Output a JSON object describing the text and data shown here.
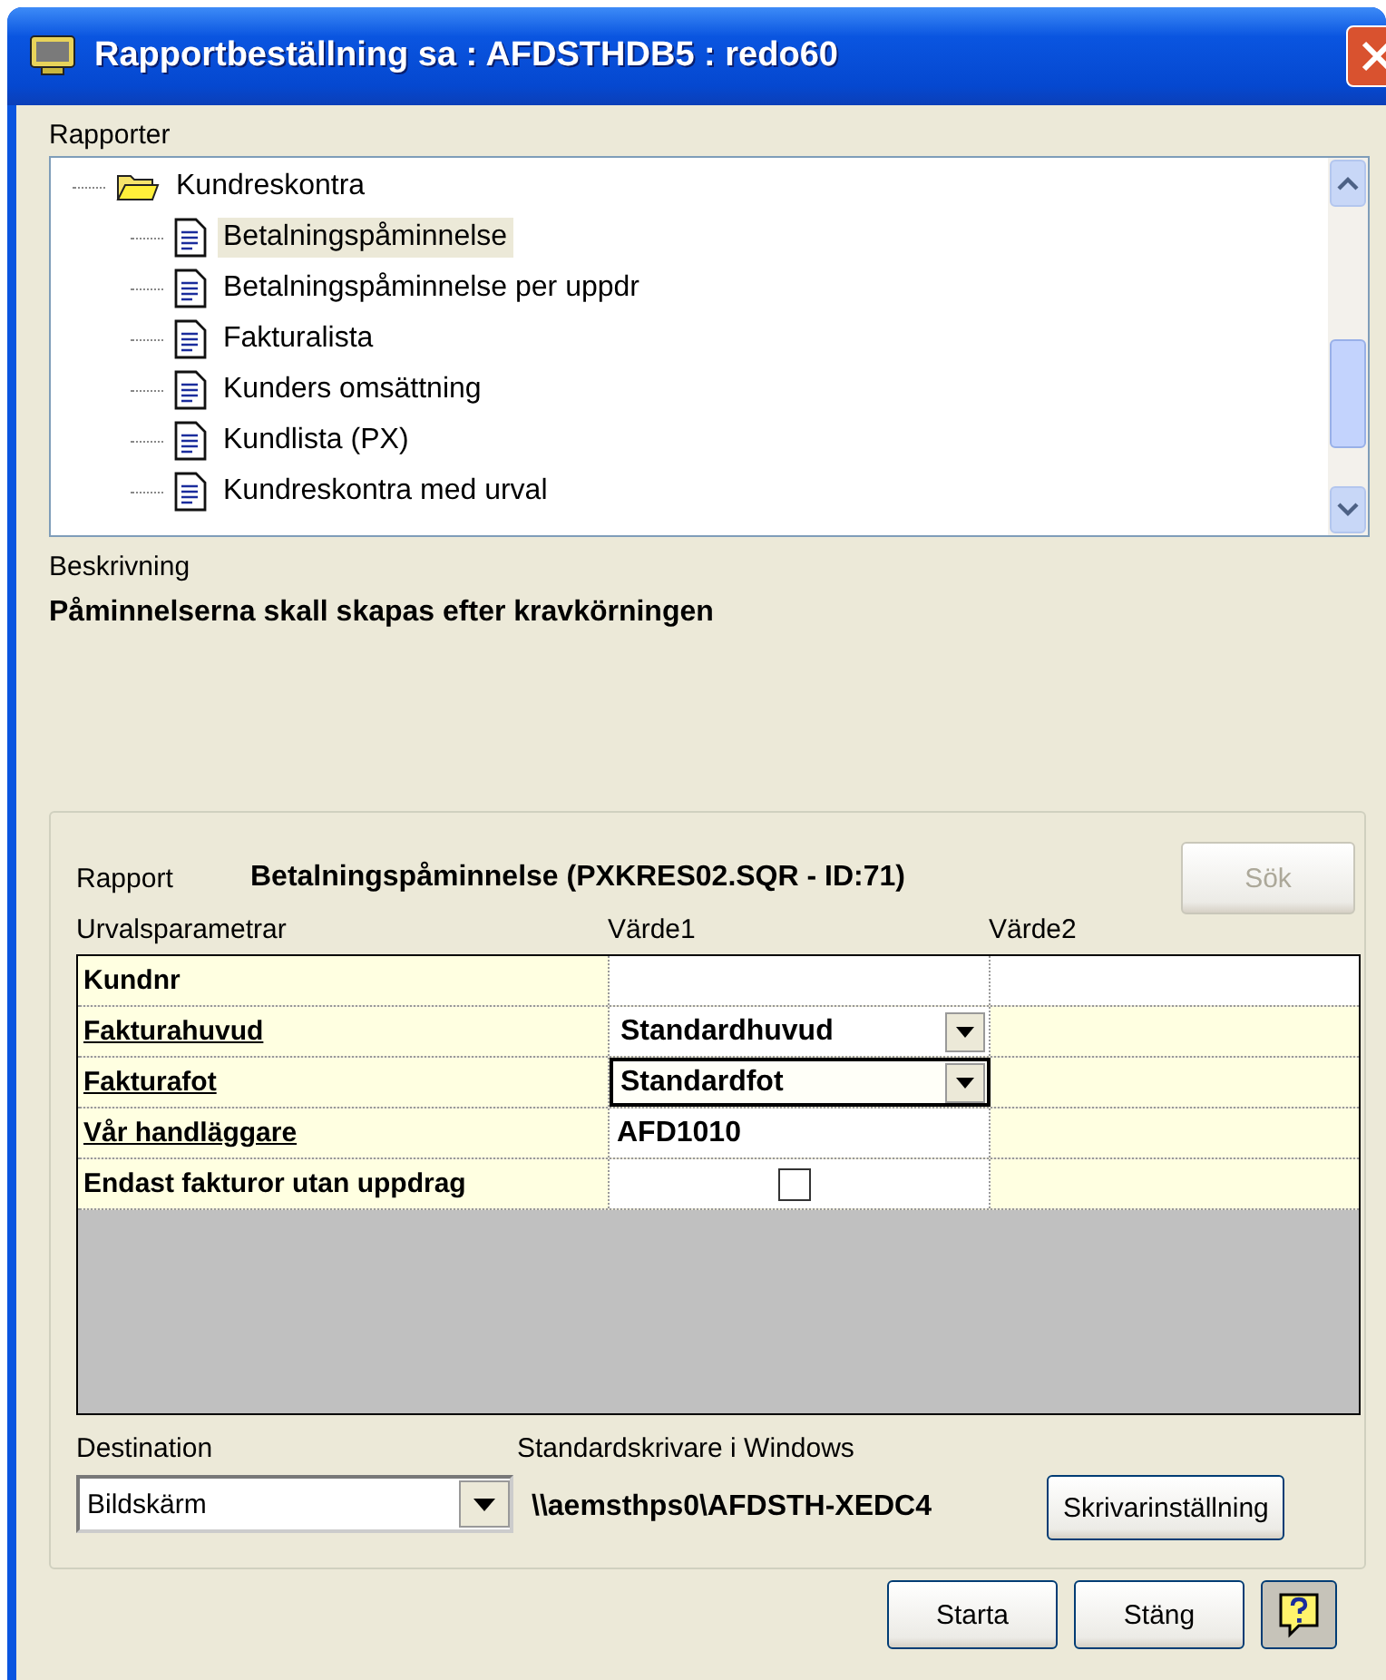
{
  "window": {
    "title": "Rapportbeställning sa : AFDSTHDB5 : redo60"
  },
  "reports": {
    "label": "Rapporter",
    "tree": [
      {
        "label": "Kundreskontra",
        "kind": "folder",
        "selected": false,
        "children": [
          {
            "label": "Betalningspåminnelse",
            "kind": "report",
            "selected": true
          },
          {
            "label": "Betalningspåminnelse per uppdr",
            "kind": "report",
            "selected": false
          },
          {
            "label": "Fakturalista",
            "kind": "report",
            "selected": false
          },
          {
            "label": "Kunders omsättning",
            "kind": "report",
            "selected": false
          },
          {
            "label": "Kundlista (PX)",
            "kind": "report",
            "selected": false
          },
          {
            "label": "Kundreskontra med urval",
            "kind": "report",
            "selected": false
          }
        ]
      }
    ]
  },
  "description": {
    "label": "Beskrivning",
    "text": "Påminnelserna skall skapas efter kravkörningen"
  },
  "report": {
    "label": "Rapport",
    "value": "Betalningspåminnelse  (PXKRES02.SQR - ID:71)",
    "search_button": {
      "label": "Sök",
      "disabled": true
    }
  },
  "parameters": {
    "columns": [
      "Urvalsparametrar",
      "Värde1",
      "Värde2"
    ],
    "rows": [
      {
        "label": "Kundnr",
        "underlined": false,
        "kind": "text",
        "value": "",
        "value2_editable": true,
        "focused": false
      },
      {
        "label": "Fakturahuvud",
        "underlined": true,
        "kind": "combo",
        "value": "Standardhuvud",
        "value2_editable": false,
        "focused": false
      },
      {
        "label": "Fakturafot",
        "underlined": true,
        "kind": "combo",
        "value": "Standardfot",
        "value2_editable": false,
        "focused": true
      },
      {
        "label": "Vår handläggare",
        "underlined": true,
        "kind": "text",
        "value": "AFD1010",
        "value2_editable": false,
        "focused": false
      },
      {
        "label": "Endast fakturor utan uppdrag",
        "underlined": false,
        "kind": "checkbox",
        "checked": false,
        "value2_editable": false,
        "focused": false
      }
    ]
  },
  "destination": {
    "label": "Destination",
    "value": "Bildskärm"
  },
  "printer": {
    "label": "Standardskrivare i Windows",
    "path": "\\\\aemsthps0\\AFDSTH-XEDC4",
    "button": "Skrivarinställning"
  },
  "buttons": [
    "Starta",
    "Stäng"
  ]
}
